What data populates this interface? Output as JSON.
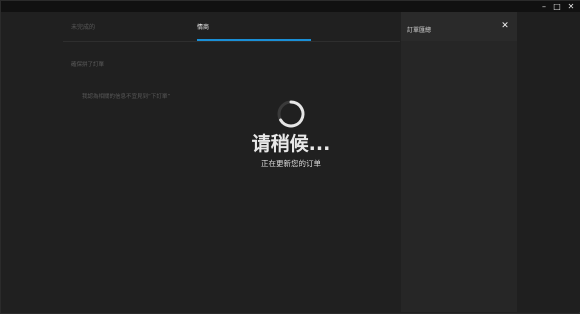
{
  "window": {
    "controls": {
      "minimize": "–",
      "maximize": "□",
      "close": "✕"
    }
  },
  "main": {
    "tabs": [
      {
        "label": "未完成的",
        "active": false
      },
      {
        "label": "情商",
        "active": true
      }
    ],
    "section_title": "確保拼了訂單",
    "empty_hint": "我認為相關的信息不宜見到“下訂單”"
  },
  "side_panel": {
    "title": "訂單匯總",
    "close_icon": "✕"
  },
  "loading": {
    "title": "请稍候...",
    "subtitle": "正在更新您的订单"
  },
  "colors": {
    "accent": "#1a8fd6",
    "background": "#202020",
    "titlebar": "#111111",
    "panel": "#262626"
  }
}
